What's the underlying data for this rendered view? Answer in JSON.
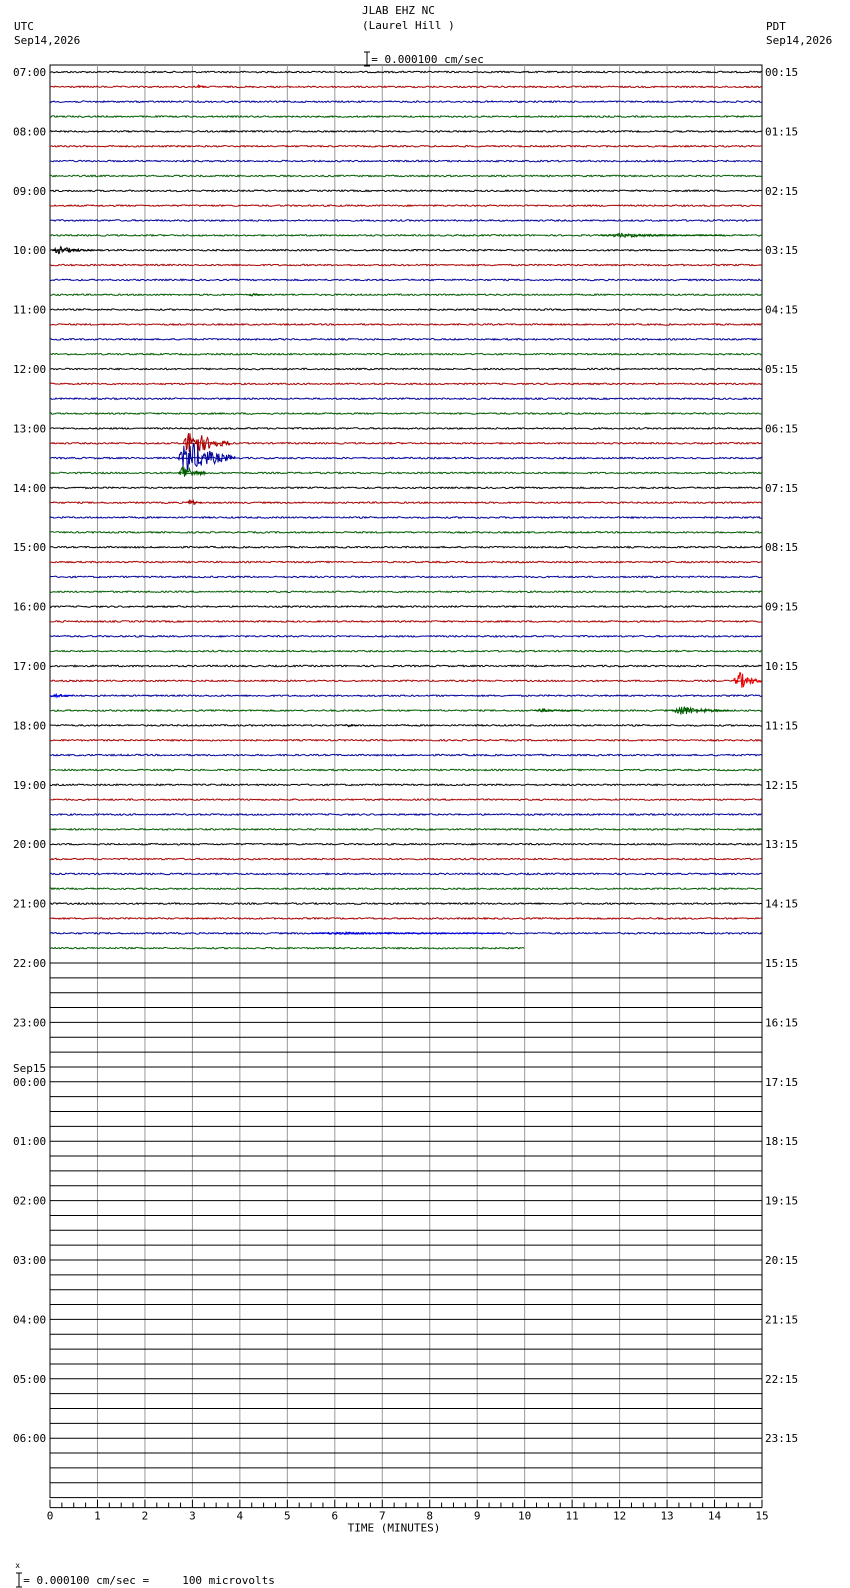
{
  "header": {
    "station": "JLAB EHZ NC",
    "location": "(Laurel Hill )",
    "left_tz": "UTC",
    "left_date": "Sep14,2026",
    "right_tz": "PDT",
    "right_date": "Sep14,2026",
    "scale_text": "= 0.000100 cm/sec"
  },
  "footer": {
    "scale_text": "= 0.000100 cm/sec =     100 microvolts"
  },
  "colors": {
    "trace": [
      "#000000",
      "#aa0000",
      "#00009c",
      "#005c00"
    ],
    "grid": "#999999"
  },
  "chart_data": {
    "type": "line",
    "xlabel": "TIME (MINUTES)",
    "xlim": [
      0,
      15
    ],
    "x_ticks": [
      "0",
      "1",
      "2",
      "3",
      "4",
      "5",
      "6",
      "7",
      "8",
      "9",
      "10",
      "11",
      "12",
      "13",
      "14",
      "15"
    ],
    "lines_per_hour": 4,
    "minutes_per_line": 15,
    "total_lines": 96,
    "recorded_lines": 60,
    "last_line_end_minute": 10,
    "left_hour_labels": [
      "07:00",
      "08:00",
      "09:00",
      "10:00",
      "11:00",
      "12:00",
      "13:00",
      "14:00",
      "15:00",
      "16:00",
      "17:00",
      "18:00",
      "19:00",
      "20:00",
      "21:00",
      "22:00",
      "23:00",
      "00:00",
      "01:00",
      "02:00",
      "03:00",
      "04:00",
      "05:00",
      "06:00"
    ],
    "left_date_change": {
      "hour_index": 17,
      "label": "Sep15"
    },
    "right_hour_labels": [
      "00:15",
      "01:15",
      "02:15",
      "03:15",
      "04:15",
      "05:15",
      "06:15",
      "07:15",
      "08:15",
      "09:15",
      "10:15",
      "11:15",
      "12:15",
      "13:15",
      "14:15",
      "15:15",
      "16:15",
      "17:15",
      "18:15",
      "19:15",
      "20:15",
      "21:15",
      "22:15",
      "23:15"
    ],
    "events": [
      {
        "line": 1,
        "minute": 3.1,
        "amp": 3,
        "dur": 0.2,
        "color": "#cc0000"
      },
      {
        "line": 11,
        "minute": 11.6,
        "amp": 3,
        "dur": 2.6
      },
      {
        "line": 12,
        "minute": 0.05,
        "amp": 6,
        "dur": 0.9
      },
      {
        "line": 15,
        "minute": 4.2,
        "amp": 3,
        "dur": 0.3
      },
      {
        "line": 25,
        "minute": 2.8,
        "amp": 22,
        "dur": 1.0
      },
      {
        "line": 26,
        "minute": 2.7,
        "amp": 28,
        "dur": 1.2
      },
      {
        "line": 27,
        "minute": 2.7,
        "amp": 14,
        "dur": 0.6
      },
      {
        "line": 29,
        "minute": 2.9,
        "amp": 6,
        "dur": 0.3
      },
      {
        "line": 41,
        "minute": 14.4,
        "amp": 16,
        "dur": 0.6,
        "color": "#ee0000"
      },
      {
        "line": 42,
        "minute": 0.0,
        "amp": 4,
        "dur": 0.5,
        "color": "#0000ee"
      },
      {
        "line": 43,
        "minute": 10.2,
        "amp": 3,
        "dur": 1.0
      },
      {
        "line": 43,
        "minute": 13.1,
        "amp": 8,
        "dur": 1.2
      },
      {
        "line": 44,
        "minute": 6.2,
        "amp": 3,
        "dur": 0.3
      },
      {
        "line": 58,
        "minute": 5.5,
        "amp": 2,
        "dur": 4.0,
        "color": "#0000ee"
      }
    ]
  }
}
